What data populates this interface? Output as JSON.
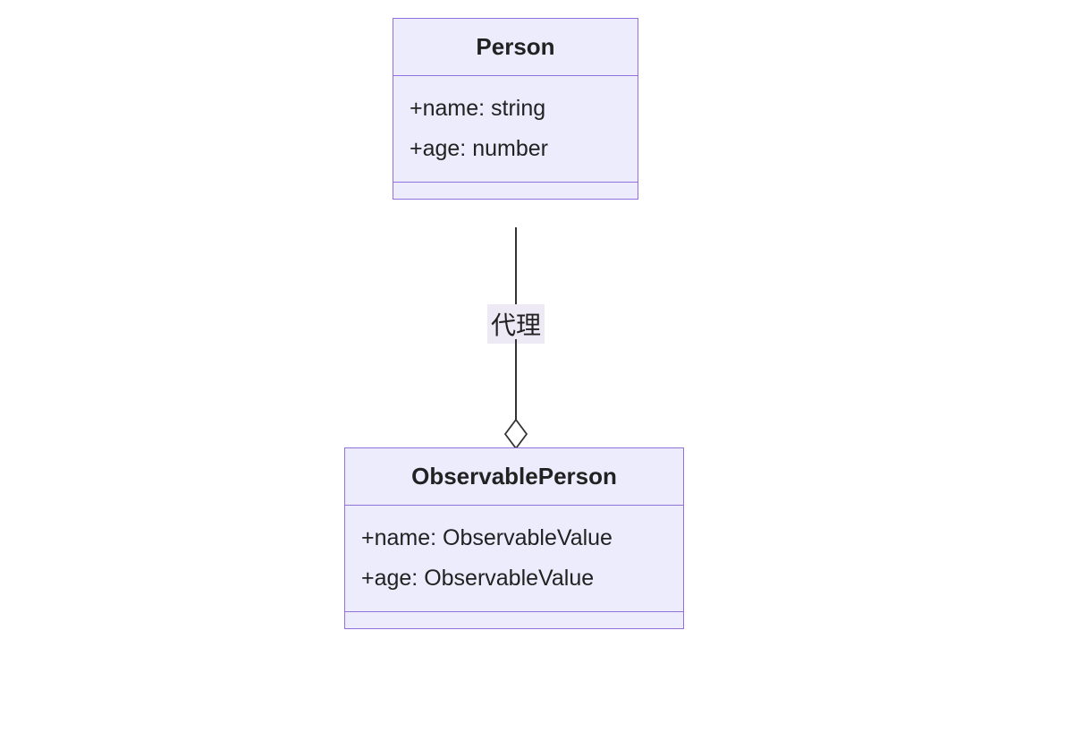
{
  "diagram": {
    "classes": {
      "person": {
        "title": "Person",
        "attrs": [
          "+name: string",
          "+age: number"
        ]
      },
      "observable": {
        "title": "ObservablePerson",
        "attrs": [
          "+name: ObservableValue",
          "+age: ObservableValue"
        ]
      }
    },
    "edge": {
      "label": "代理",
      "type": "aggregation"
    }
  }
}
